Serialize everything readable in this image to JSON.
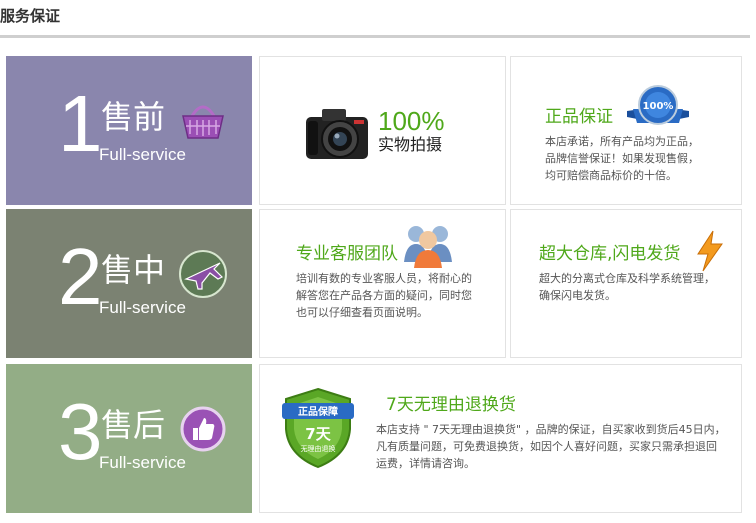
{
  "page": {
    "title": "服务保证"
  },
  "stages": [
    {
      "num": "1",
      "zh": "售前",
      "en": "Full-service",
      "icon": "basket-icon"
    },
    {
      "num": "2",
      "zh": "售中",
      "en": "Full-service",
      "icon": "airplane-icon"
    },
    {
      "num": "3",
      "zh": "售后",
      "en": "Full-service",
      "icon": "thumbs-up-icon"
    }
  ],
  "cards": {
    "photo": {
      "big": "100%",
      "sub": "实物拍摄",
      "icon": "camera-icon"
    },
    "genuine": {
      "title": "正品保证",
      "lines": [
        "本店承诺，所有产品均为正品，",
        "品牌信誉保证！如果发现售假，",
        "均可赔偿商品标价的十倍。"
      ],
      "badge_text": "100%",
      "icon": "quality-badge-icon"
    },
    "team": {
      "title": "专业客服团队",
      "lines": [
        "培训有数的专业客服人员，将耐心的",
        "解答您在产品各方面的疑问，同时您",
        "也可以仔细查看页面说明。"
      ],
      "icon": "customer-service-icon"
    },
    "warehouse": {
      "title": "超大仓库,闪电发货",
      "lines": [
        "超大的分离式仓库及科学系统管理，",
        "确保闪电发货。"
      ],
      "icon": "lightning-icon"
    },
    "returns": {
      "title": "7天无理由退换货",
      "lines": [
        "本店支持 \" 7天无理由退换货\" ，品牌的保证，自买家收到货后45日内，",
        "凡有质量问题，可免费退换货，如因个人喜好问题，买家只需承担退回",
        "运费，详情请咨询。"
      ],
      "shield_top": "正品保障",
      "shield_main": "7天",
      "shield_sub": "无理由退换",
      "icon": "shield-icon"
    }
  },
  "colors": {
    "stage1": "#8a86ad",
    "stage2": "#7b8272",
    "stage3": "#93ad86",
    "accent_green": "#4fa81a"
  }
}
